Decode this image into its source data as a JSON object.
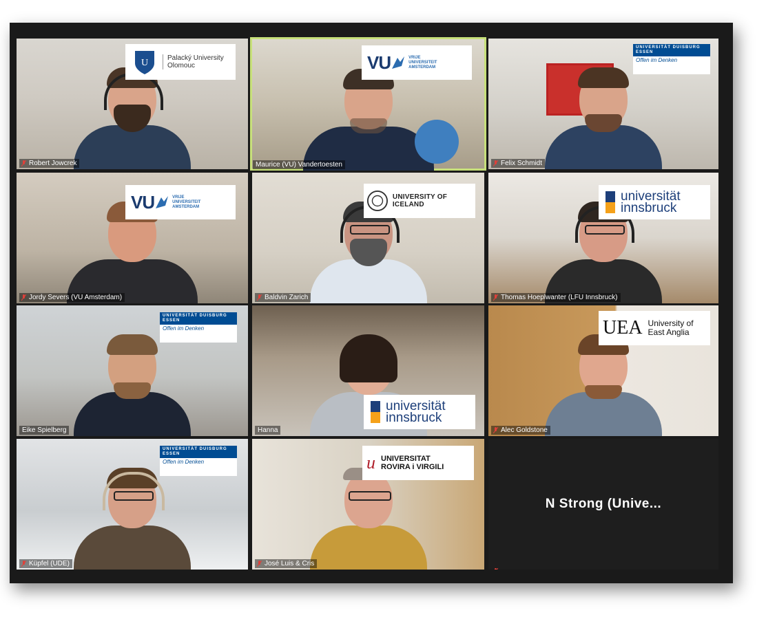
{
  "app": {
    "title": "Zoom gallery view"
  },
  "participants": [
    {
      "name": "Robert Jowcrek",
      "logo": {
        "line1": "Palacký University",
        "line2": "Olomouc"
      }
    },
    {
      "name": "Maurice (VU) Vandertoesten",
      "active": true,
      "logo": {
        "mark": "VU",
        "line1": "VRIJE",
        "line2": "UNIVERSITEIT",
        "line3": "AMSTERDAM"
      }
    },
    {
      "name": "Felix Schmidt",
      "logo": {
        "line1": "UNIVERSITÄT DUISBURG ESSEN",
        "line2": "Offen im Denken"
      }
    },
    {
      "name": "Jordy Severs (VU Amsterdam)",
      "logo": {
        "mark": "VU",
        "line1": "VRIJE",
        "line2": "UNIVERSITEIT",
        "line3": "AMSTERDAM"
      }
    },
    {
      "name": "Baldvin Zarich",
      "logo": {
        "line1": "UNIVERSITY OF ICELAND"
      }
    },
    {
      "name": "Thomas Hoeplwanter (LFU Innsbruck)",
      "logo": {
        "line1": "universität",
        "line2": "innsbruck"
      }
    },
    {
      "name": "Eike Spielberg",
      "logo": {
        "line1": "UNIVERSITÄT DUISBURG ESSEN",
        "line2": "Offen im Denken"
      }
    },
    {
      "name": "Hanna",
      "logo": {
        "line1": "universität",
        "line2": "innsbruck"
      }
    },
    {
      "name": "Alec Goldstone",
      "logo": {
        "mark": "UEA",
        "line1": "University of",
        "line2": "East Anglia"
      }
    },
    {
      "name": "Küpfel (UDE)",
      "logo": {
        "line1": "UNIVERSITÄT DUISBURG ESSEN",
        "line2": "Offen im Denken"
      }
    },
    {
      "name": "José Luis & Cris",
      "logo": {
        "line1": "UNIVERSITAT",
        "line2": "ROVIRA i VIRGILI"
      }
    },
    {
      "name": "",
      "display_name": "N Strong (Unive..."
    }
  ],
  "colors": {
    "active_border": "#c7e07a",
    "mute": "#e0403a",
    "ude_blue": "#004c93",
    "uibk_blue": "#1d3f7a",
    "uibk_orange": "#f5a11a"
  }
}
